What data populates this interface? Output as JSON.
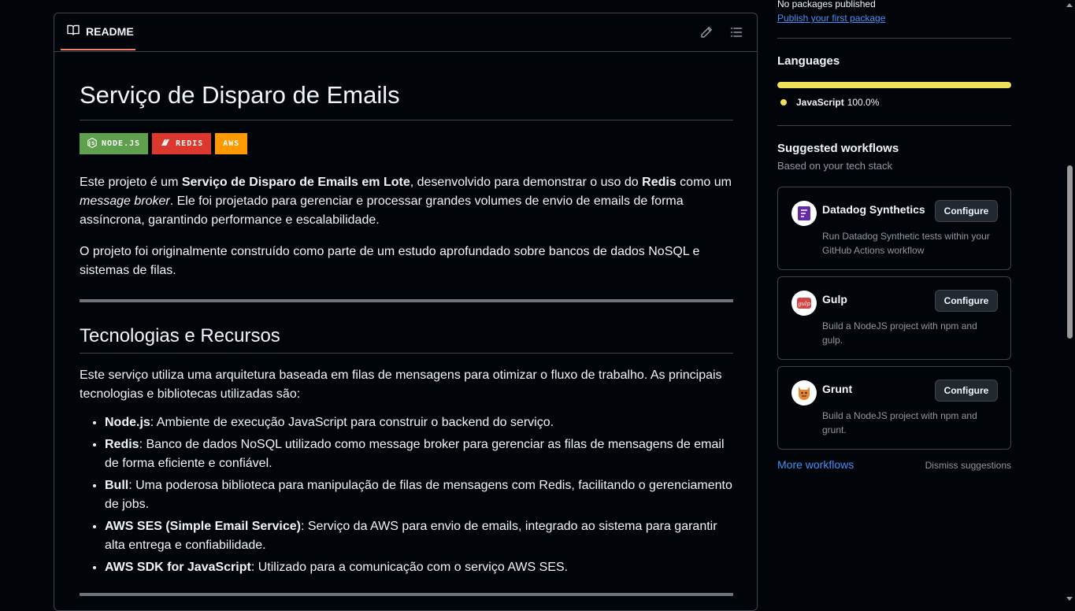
{
  "readme": {
    "tab_label": "README",
    "title": "Serviço de Disparo de Emails",
    "badges": [
      {
        "label": "NODE.JS",
        "color": "#5fa04e"
      },
      {
        "label": "REDIS",
        "color": "#dc382d"
      },
      {
        "label": "AWS",
        "color": "#ff9900"
      }
    ],
    "para1": {
      "t1": "Este projeto é um ",
      "b1": "Serviço de Disparo de Emails em Lote",
      "t2": ", desenvolvido para demonstrar o uso do ",
      "b2": "Redis",
      "t3": " como um ",
      "i1": "message broker",
      "t4": ". Ele foi projetado para gerenciar e processar grandes volumes de envio de emails de forma assíncrona, garantindo performance e escalabilidade."
    },
    "para2": "O projeto foi originalmente construído como parte de um estudo aprofundado sobre bancos de dados NoSQL e sistemas de filas.",
    "section_title": "Tecnologias e Recursos",
    "section_intro": "Este serviço utiliza uma arquitetura baseada em filas de mensagens para otimizar o fluxo de trabalho. As principais tecnologias e bibliotecas utilizadas são:",
    "tech_list": [
      {
        "name": "Node.js",
        "desc": ": Ambiente de execução JavaScript para construir o backend do serviço."
      },
      {
        "name": "Redis",
        "desc": ": Banco de dados NoSQL utilizado como message broker para gerenciar as filas de mensagens de email de forma eficiente e confiável."
      },
      {
        "name": "Bull",
        "desc": ": Uma poderosa biblioteca para manipulação de filas de mensagens com Redis, facilitando o gerenciamento de jobs."
      },
      {
        "name": "AWS SES (Simple Email Service)",
        "desc": ": Serviço da AWS para envio de emails, integrado ao sistema para garantir alta entrega e confiabilidade."
      },
      {
        "name": "AWS SDK for JavaScript",
        "desc": ": Utilizado para a comunicação com o serviço AWS SES."
      }
    ]
  },
  "sidebar": {
    "packages_text": "No packages published",
    "publish_link": "Publish your first package",
    "languages_title": "Languages",
    "language": {
      "name": "JavaScript",
      "percent": "100.0%",
      "color": "#f1e05a"
    },
    "suggested_title": "Suggested workflows",
    "suggested_subtitle": "Based on your tech stack",
    "workflows": [
      {
        "name": "Datadog Synthetics",
        "button": "Configure",
        "desc": "Run Datadog Synthetic tests within your GitHub Actions workflow"
      },
      {
        "name": "Gulp",
        "button": "Configure",
        "desc": "Build a NodeJS project with npm and gulp."
      },
      {
        "name": "Grunt",
        "button": "Configure",
        "desc": "Build a NodeJS project with npm and grunt."
      }
    ],
    "more_workflows": "More workflows",
    "dismiss": "Dismiss suggestions"
  }
}
